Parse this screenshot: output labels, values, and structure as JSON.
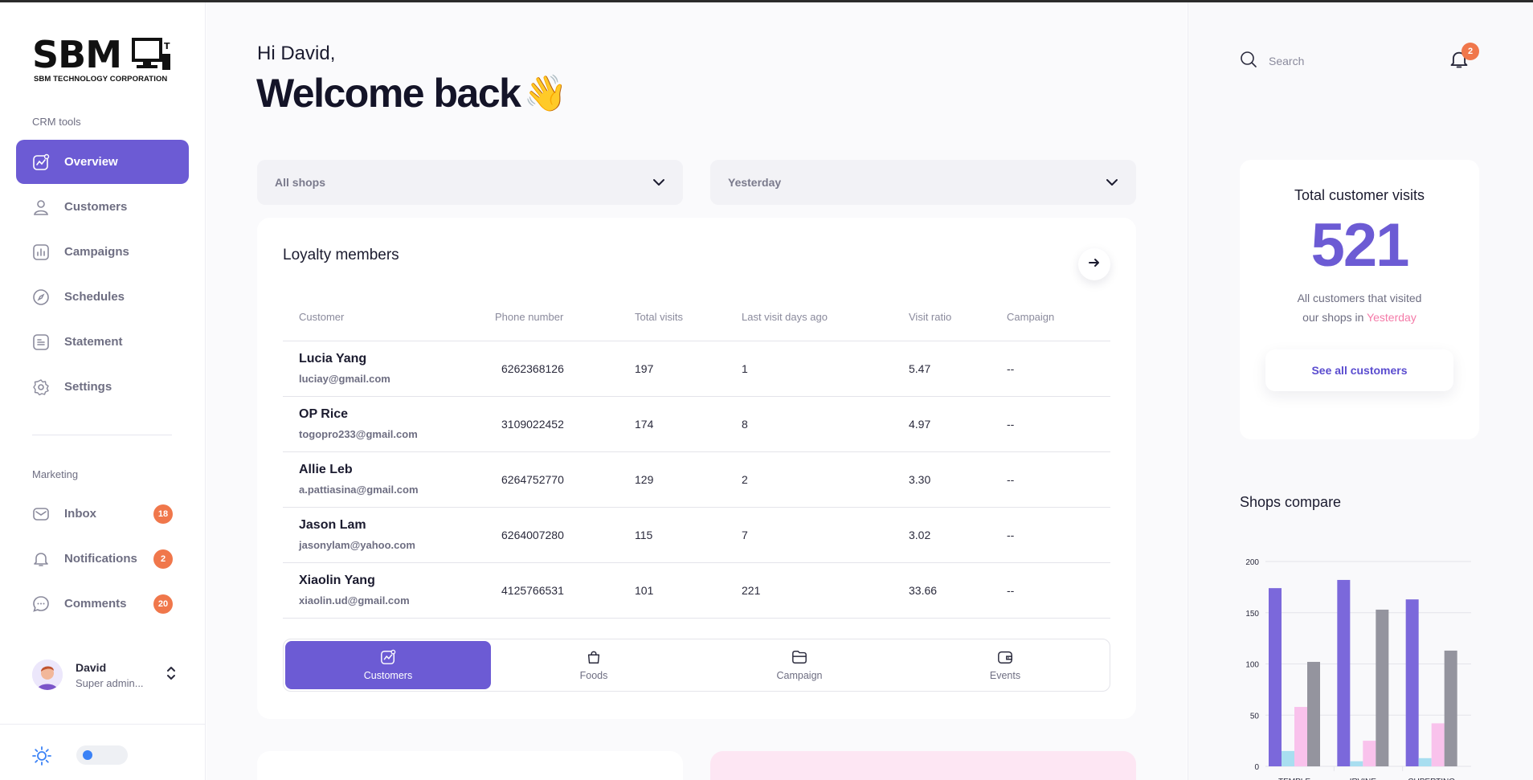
{
  "sidebar": {
    "logo": {
      "main": "SBM",
      "subtitle": "SBM TECHNOLOGY CORPORATION"
    },
    "crm_label": "CRM tools",
    "crm_items": [
      {
        "label": "Overview",
        "icon": "chart-icon",
        "active": true
      },
      {
        "label": "Customers",
        "icon": "user-icon"
      },
      {
        "label": "Campaigns",
        "icon": "bar-chart-icon"
      },
      {
        "label": "Schedules",
        "icon": "compass-icon"
      },
      {
        "label": "Statement",
        "icon": "document-icon"
      },
      {
        "label": "Settings",
        "icon": "gear-icon"
      }
    ],
    "marketing_label": "Marketing",
    "marketing_items": [
      {
        "label": "Inbox",
        "icon": "mail-icon",
        "badge": "18"
      },
      {
        "label": "Notifications",
        "icon": "bell-icon",
        "badge": "2"
      },
      {
        "label": "Comments",
        "icon": "comment-icon",
        "badge": "20"
      }
    ],
    "user": {
      "name": "David",
      "role": "Super admin..."
    }
  },
  "header": {
    "greeting": "Hi David,",
    "welcome": "Welcome back",
    "welcome_emoji": "👋"
  },
  "filters": {
    "shop": "All shops",
    "period": "Yesterday"
  },
  "loyalty": {
    "title": "Loyalty members",
    "columns": [
      "Customer",
      "Phone number",
      "Total visits",
      "Last visit days ago",
      "Visit ratio",
      "Campaign"
    ],
    "rows": [
      {
        "name": "Lucia Yang",
        "email": "luciay@gmail.com",
        "phone": "6262368126",
        "visits": "197",
        "last": "1",
        "ratio": "5.47",
        "campaign": "--"
      },
      {
        "name": "OP Rice",
        "email": "togopro233@gmail.com",
        "phone": "3109022452",
        "visits": "174",
        "last": "8",
        "ratio": "4.97",
        "campaign": "--"
      },
      {
        "name": "Allie Leb",
        "email": "a.pattiasina@gmail.com",
        "phone": "6264752770",
        "visits": "129",
        "last": "2",
        "ratio": "3.30",
        "campaign": "--"
      },
      {
        "name": "Jason Lam",
        "email": "jasonylam@yahoo.com",
        "phone": "6264007280",
        "visits": "115",
        "last": "7",
        "ratio": "3.02",
        "campaign": "--"
      },
      {
        "name": "Xiaolin Yang",
        "email": "xiaolin.ud@gmail.com",
        "phone": "4125766531",
        "visits": "101",
        "last": "221",
        "ratio": "33.66",
        "campaign": "--"
      }
    ],
    "tabs": [
      {
        "label": "Customers",
        "icon": "chart-icon",
        "active": true
      },
      {
        "label": "Foods",
        "icon": "bag-icon"
      },
      {
        "label": "Campaign",
        "icon": "folder-icon"
      },
      {
        "label": "Events",
        "icon": "wallet-icon"
      }
    ]
  },
  "right_panel": {
    "search_placeholder": "Search",
    "bell_badge": "2",
    "visits": {
      "title": "Total customer visits",
      "value": "521",
      "desc_line1": "All customers that visited",
      "desc_line2": "our shops in",
      "desc_highlight": "Yesterday",
      "button": "See all customers"
    },
    "compare_title": "Shops compare"
  },
  "colors": {
    "accent": "#6c5bd4",
    "badge": "#f0774b",
    "highlight": "#f47aa8",
    "series": [
      "#7b68db",
      "#a8def0",
      "#f9c2ec",
      "#94949e"
    ]
  },
  "chart_data": {
    "type": "bar",
    "title": "Shops compare",
    "categories": [
      "TEMPLE",
      "IRVINE",
      "CUPERTINO"
    ],
    "series": [
      {
        "values": [
          174,
          182,
          163
        ]
      },
      {
        "values": [
          15,
          5,
          8
        ]
      },
      {
        "values": [
          58,
          25,
          42
        ]
      },
      {
        "values": [
          102,
          153,
          113
        ]
      }
    ],
    "ylim": [
      0,
      200
    ],
    "yticks": [
      0,
      50,
      100,
      150,
      200
    ],
    "grid": true
  }
}
